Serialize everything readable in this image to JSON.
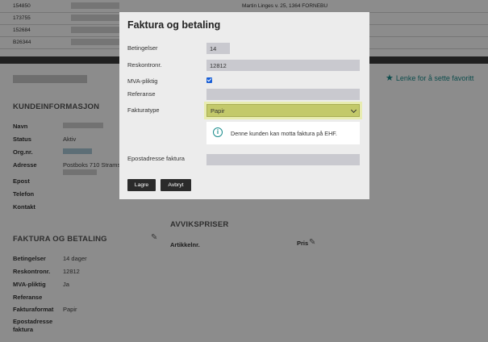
{
  "background": {
    "table_rows": [
      {
        "id": "154850",
        "address": "Martin Linges v. 25, 1364 FORNEBU"
      },
      {
        "id": "173755",
        "address": ""
      },
      {
        "id": "152684",
        "address": ""
      },
      {
        "id": "B26344",
        "address": ""
      }
    ],
    "favorite_link": "Lenke for å sette favoritt",
    "kundeinfo": {
      "title": "KUNDEINFORMASJON",
      "labels": {
        "navn": "Navn",
        "status": "Status",
        "orgnr": "Org.nr.",
        "adresse": "Adresse",
        "epost": "Epost",
        "telefon": "Telefon",
        "kontakt": "Kontakt"
      },
      "status_value": "Aktiv",
      "adresse_value": "Postboks 710 Strams"
    },
    "faktura": {
      "title": "FAKTURA OG BETALING",
      "labels": {
        "betingelser": "Betingelser",
        "reskontro": "Reskontronr.",
        "mva": "MVA-pliktig",
        "referanse": "Referanse",
        "fakturaformat": "Fakturaformat",
        "epost": "Epostadresse faktura"
      },
      "values": {
        "betingelser": "14 dager",
        "reskontro": "12812",
        "mva": "Ja",
        "fakturaformat": "Papir"
      }
    },
    "avvik": {
      "title": "AVVIKSPRISER",
      "artikkelnr": "Artikkelnr.",
      "pris": "Pris"
    }
  },
  "modal": {
    "title": "Faktura og betaling",
    "fields": {
      "betingelser": {
        "label": "Betingelser",
        "value": "14"
      },
      "reskontro": {
        "label": "Reskontronr.",
        "value": "12812"
      },
      "mva": {
        "label": "MVA-pliktig",
        "checked": true
      },
      "referanse": {
        "label": "Referanse",
        "value": ""
      },
      "fakturatype": {
        "label": "Fakturatype",
        "selected": "Papir"
      },
      "epost": {
        "label": "Epostadresse faktura",
        "value": ""
      }
    },
    "info_message": "Denne kunden kan motta faktura på EHF.",
    "save_label": "Lagre",
    "cancel_label": "Avbryt"
  },
  "colors": {
    "accent": "#1a8c8c",
    "select_highlight": "#c3c96a",
    "button": "#2b2b2b"
  }
}
